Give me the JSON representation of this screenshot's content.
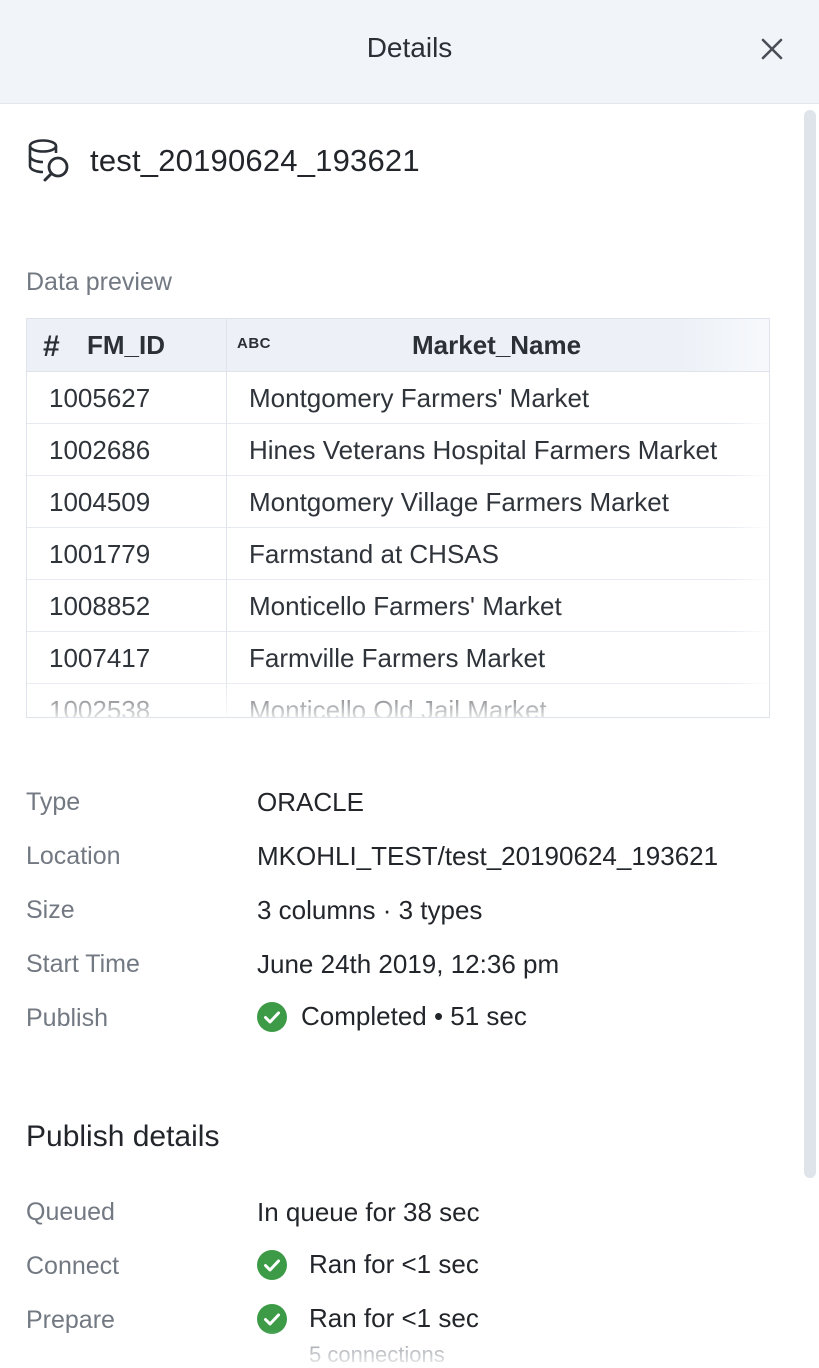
{
  "header": {
    "title": "Details"
  },
  "dataset": {
    "name": "test_20190624_193621",
    "icon": "dataset-search-icon"
  },
  "preview": {
    "label": "Data preview",
    "columns": [
      {
        "type_glyph": "#",
        "name": "FM_ID"
      },
      {
        "type_glyph": "ABC",
        "name": "Market_Name"
      }
    ],
    "rows": [
      {
        "id": "1005627",
        "name": "Montgomery Farmers' Market"
      },
      {
        "id": "1002686",
        "name": "Hines Veterans Hospital Farmers Market"
      },
      {
        "id": "1004509",
        "name": "Montgomery Village Farmers Market"
      },
      {
        "id": "1001779",
        "name": "Farmstand at CHSAS"
      },
      {
        "id": "1008852",
        "name": "Monticello Farmers' Market"
      },
      {
        "id": "1007417",
        "name": "Farmville Farmers Market"
      },
      {
        "id": "1002538",
        "name": "Monticello Old Jail Market"
      }
    ]
  },
  "details": {
    "type": {
      "label": "Type",
      "value": "ORACLE"
    },
    "location": {
      "label": "Location",
      "value": "MKOHLI_TEST/test_20190624_193621"
    },
    "size": {
      "label": "Size",
      "value": "3 columns · 3 types"
    },
    "start_time": {
      "label": "Start Time",
      "value": "June 24th 2019, 12:36 pm"
    },
    "publish": {
      "label": "Publish",
      "value": "Completed • 51 sec",
      "status_color": "#3d9b48"
    }
  },
  "publish_details": {
    "title": "Publish details",
    "queued": {
      "label": "Queued",
      "value": "In queue for 38 sec"
    },
    "connect": {
      "label": "Connect",
      "value": "Ran for <1 sec"
    },
    "prepare": {
      "label": "Prepare",
      "value": "Ran for <1 sec",
      "note": "5 connections"
    }
  },
  "colors": {
    "header_bg": "#f1f4f9",
    "success": "#3d9b48",
    "muted_text": "#737982"
  }
}
